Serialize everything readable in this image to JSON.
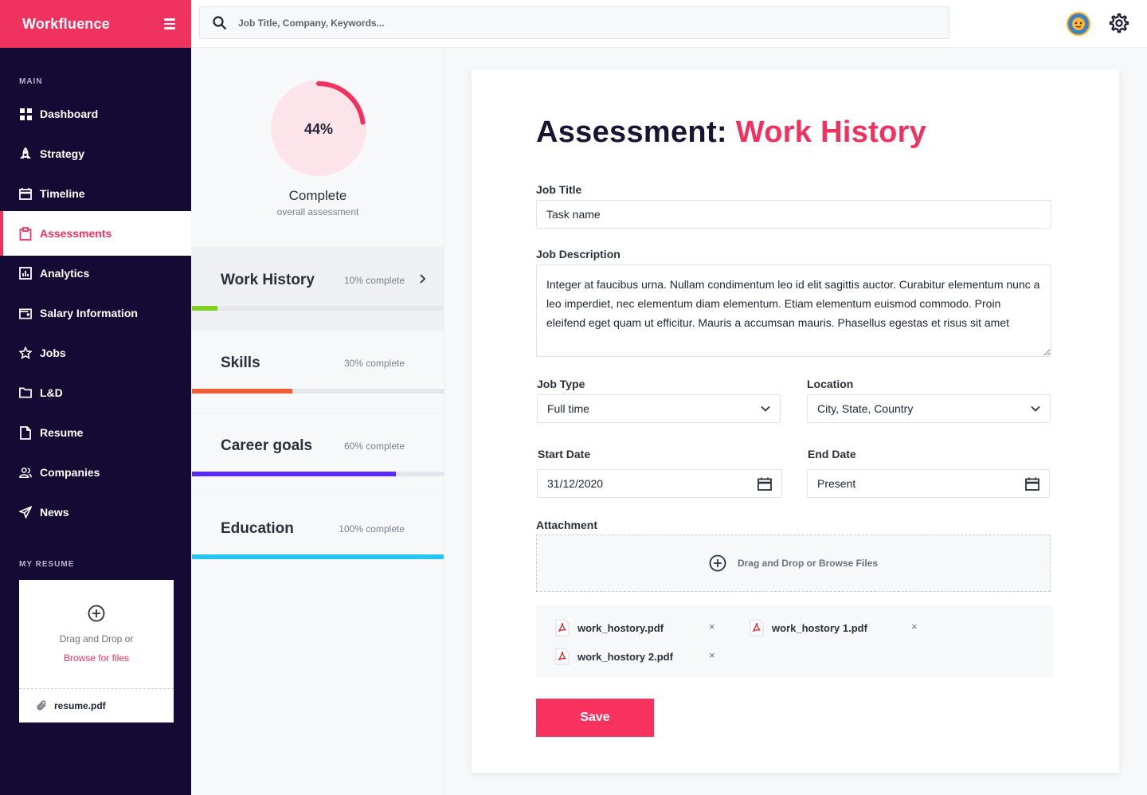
{
  "app": {
    "brand": "Workfluence"
  },
  "sidebar": {
    "main_label": "MAIN",
    "items": [
      {
        "label": "Dashboard",
        "icon": "grid-icon"
      },
      {
        "label": "Strategy",
        "icon": "rocket-icon"
      },
      {
        "label": "Timeline",
        "icon": "calendar-icon"
      },
      {
        "label": "Assessments",
        "icon": "clipboard-icon",
        "active": true
      },
      {
        "label": "Analytics",
        "icon": "chart-icon"
      },
      {
        "label": "Salary Information",
        "icon": "wallet-icon"
      },
      {
        "label": "Jobs",
        "icon": "star-icon"
      },
      {
        "label": "L&D",
        "icon": "folder-icon"
      },
      {
        "label": "Resume",
        "icon": "file-icon"
      },
      {
        "label": "Companies",
        "icon": "users-icon"
      },
      {
        "label": "News",
        "icon": "send-icon"
      }
    ],
    "resume_label": "MY RESUME",
    "resume_drop_line1": "Drag and Drop or",
    "resume_drop_line2": "Browse for files",
    "resume_file": "resume.pdf"
  },
  "topbar": {
    "search_placeholder": "Job Title, Company, Keywords..."
  },
  "progress": {
    "percent": 44,
    "percent_text": "44%",
    "label": "Complete",
    "sub": "overall assessment"
  },
  "sections": [
    {
      "title": "Work History",
      "pct_text": "10% complete",
      "percent": 10,
      "color": "#7ed321",
      "active": true
    },
    {
      "title": "Skills",
      "pct_text": "30% complete",
      "percent": 40,
      "color": "#f25c35"
    },
    {
      "title": "Career goals",
      "pct_text": "60% complete",
      "percent": 81,
      "color": "#5b2bf1"
    },
    {
      "title": "Education",
      "pct_text": "100% complete",
      "percent": 100,
      "color": "#29c4f3"
    }
  ],
  "form": {
    "heading_prefix": "Assessment:",
    "heading_accent": "Work History",
    "job_title_label": "Job Title",
    "job_title_value": "Task name",
    "job_description_label": "Job Description",
    "job_description_value": "Integer at faucibus urna. Nullam condimentum leo id elit sagittis auctor. Curabitur elementum nunc a leo imperdiet, nec elementum diam elementum. Etiam elementum euismod commodo. Proin eleifend eget quam ut efficitur. Mauris a accumsan mauris. Phasellus egestas et risus sit amet",
    "job_type_label": "Job Type",
    "job_type_value": "Full time",
    "location_label": "Location",
    "location_value": "City, State, Country",
    "start_date_label": "Start Date",
    "start_date_value": "31/12/2020",
    "end_date_label": "End Date",
    "end_date_value": "Present",
    "attachment_label": "Attachment",
    "dropzone_text": "Drag and Drop or Browse Files",
    "files": [
      "work_hostory.pdf",
      "work_hostory 1.pdf",
      "work_hostory 2.pdf"
    ],
    "remove_glyph": "×",
    "save_label": "Save"
  },
  "colors": {
    "accent": "#f0325f",
    "sidebar_bg": "#140a33"
  }
}
